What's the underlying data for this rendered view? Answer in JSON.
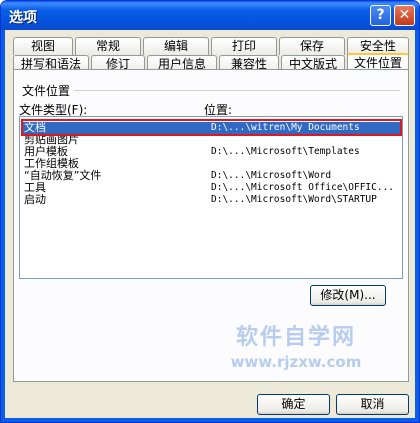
{
  "window": {
    "title": "选项",
    "help_icon": "?",
    "close_icon": "✕"
  },
  "tabs_back": [
    "视图",
    "常规",
    "编辑",
    "打印",
    "保存",
    "安全性"
  ],
  "tabs_front": [
    "拼写和语法",
    "修订",
    "用户信息",
    "兼容性",
    "中文版式",
    "文件位置"
  ],
  "active_tab": "文件位置",
  "panel": {
    "group_label": "文件位置",
    "col_type": "文件类型(F):",
    "col_location": "位置:",
    "rows": [
      {
        "type": "文档",
        "location": "D:\\...\\witren\\My Documents",
        "selected": true
      },
      {
        "type": "剪贴画图片",
        "location": ""
      },
      {
        "type": "用户模板",
        "location": "D:\\...\\Microsoft\\Templates"
      },
      {
        "type": "工作组模板",
        "location": ""
      },
      {
        "type": "“自动恢复”文件",
        "location": "D:\\...\\Microsoft\\Word"
      },
      {
        "type": "工具",
        "location": "D:\\...\\Microsoft Office\\OFFIC..."
      },
      {
        "type": "启动",
        "location": "D:\\...\\Microsoft\\Word\\STARTUP"
      }
    ],
    "modify_button": "修改(M)..."
  },
  "buttons": {
    "ok": "确定",
    "cancel": "取消"
  },
  "watermark": {
    "line1": "软件自学网",
    "line2": "www.rjzxw.com"
  }
}
